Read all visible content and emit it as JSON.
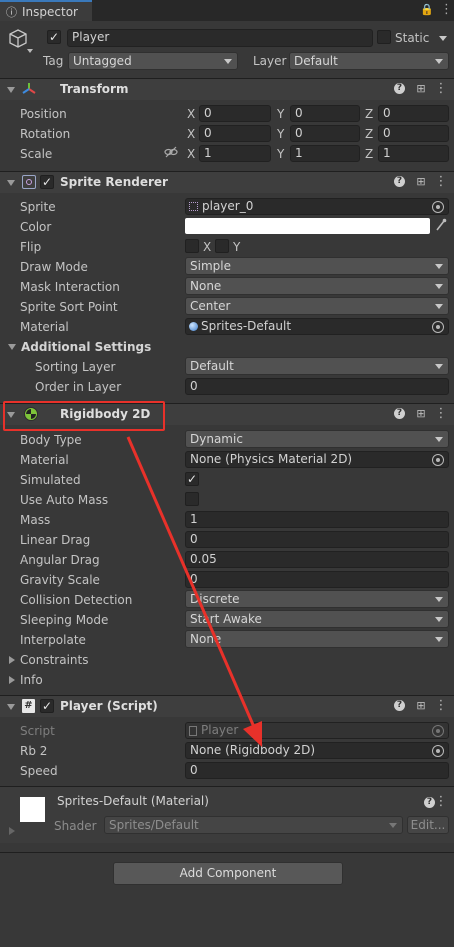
{
  "window": {
    "tab_title": "Inspector"
  },
  "object": {
    "name": "Player",
    "static_label": "Static",
    "tag_label": "Tag",
    "tag_value": "Untagged",
    "layer_label": "Layer",
    "layer_value": "Default"
  },
  "transform": {
    "title": "Transform",
    "rows": [
      {
        "label": "Position",
        "x": "0",
        "y": "0",
        "z": "0"
      },
      {
        "label": "Rotation",
        "x": "0",
        "y": "0",
        "z": "0"
      },
      {
        "label": "Scale",
        "x": "1",
        "y": "1",
        "z": "1"
      }
    ],
    "axis_x": "X",
    "axis_y": "Y",
    "axis_z": "Z"
  },
  "sprite_renderer": {
    "title": "Sprite Renderer",
    "sprite_label": "Sprite",
    "sprite_value": "player_0",
    "color_label": "Color",
    "color_value": "#ffffff",
    "flip_label": "Flip",
    "flip_x": "X",
    "flip_y": "Y",
    "draw_mode_label": "Draw Mode",
    "draw_mode_value": "Simple",
    "mask_label": "Mask Interaction",
    "mask_value": "None",
    "sort_point_label": "Sprite Sort Point",
    "sort_point_value": "Center",
    "material_label": "Material",
    "material_value": "Sprites-Default",
    "additional_label": "Additional Settings",
    "sorting_layer_label": "Sorting Layer",
    "sorting_layer_value": "Default",
    "order_label": "Order in Layer",
    "order_value": "0"
  },
  "rigidbody": {
    "title": "Rigidbody 2D",
    "body_type_label": "Body Type",
    "body_type_value": "Dynamic",
    "material_label": "Material",
    "material_value": "None (Physics Material 2D)",
    "simulated_label": "Simulated",
    "auto_mass_label": "Use Auto Mass",
    "mass_label": "Mass",
    "mass_value": "1",
    "linear_drag_label": "Linear Drag",
    "linear_drag_value": "0",
    "angular_drag_label": "Angular Drag",
    "angular_drag_value": "0.05",
    "gravity_label": "Gravity Scale",
    "gravity_value": "0",
    "collision_label": "Collision Detection",
    "collision_value": "Discrete",
    "sleeping_label": "Sleeping Mode",
    "sleeping_value": "Start Awake",
    "interpolate_label": "Interpolate",
    "interpolate_value": "None",
    "constraints_label": "Constraints",
    "info_label": "Info"
  },
  "player_script": {
    "title": "Player (Script)",
    "script_label": "Script",
    "script_value": "Player",
    "rb2_label": "Rb 2",
    "rb2_value": "None (Rigidbody 2D)",
    "speed_label": "Speed",
    "speed_value": "0"
  },
  "material_preview": {
    "title": "Sprites-Default (Material)",
    "shader_label": "Shader",
    "shader_value": "Sprites/Default",
    "edit_label": "Edit..."
  },
  "add_component_label": "Add Component",
  "colors": {
    "annotation": "#e8312a",
    "background": "#383838"
  }
}
